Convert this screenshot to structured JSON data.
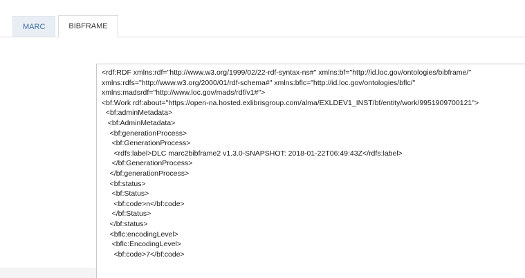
{
  "tabs": [
    {
      "label": "MARC",
      "active": false
    },
    {
      "label": "BIBFRAME",
      "active": true
    }
  ],
  "code_lines": [
    "<rdf:RDF xmlns:rdf=\"http://www.w3.org/1999/02/22-rdf-syntax-ns#\" xmlns:bf=\"http://id.loc.gov/ontologies/bibframe/\"",
    "xmlns:rdfs=\"http://www.w3.org/2000/01/rdf-schema#\" xmlns:bflc=\"http://id.loc.gov/ontologies/bflc/\"",
    "xmlns:madsrdf=\"http://www.loc.gov/mads/rdf/v1#\">",
    "<bf:Work rdf:about=\"https://open-na.hosted.exlibrisgroup.com/alma/EXLDEV1_INST/bf/entity/work/9951909700121\">",
    "  <bf:adminMetadata>",
    "   <bf:AdminMetadata>",
    "    <bf:generationProcess>",
    "     <bf:GenerationProcess>",
    "      <rdfs:label>DLC marc2bibframe2 v1.3.0-SNAPSHOT: 2018-01-22T06:49:43Z</rdfs:label>",
    "     </bf:GenerationProcess>",
    "    </bf:generationProcess>",
    "    <bf:status>",
    "     <bf:Status>",
    "      <bf:code>n</bf:code>",
    "     </bf:Status>",
    "    </bf:status>",
    "    <bflc:encodingLevel>",
    "     <bflc:EncodingLevel>",
    "      <bf:code>7</bf:code>"
  ]
}
